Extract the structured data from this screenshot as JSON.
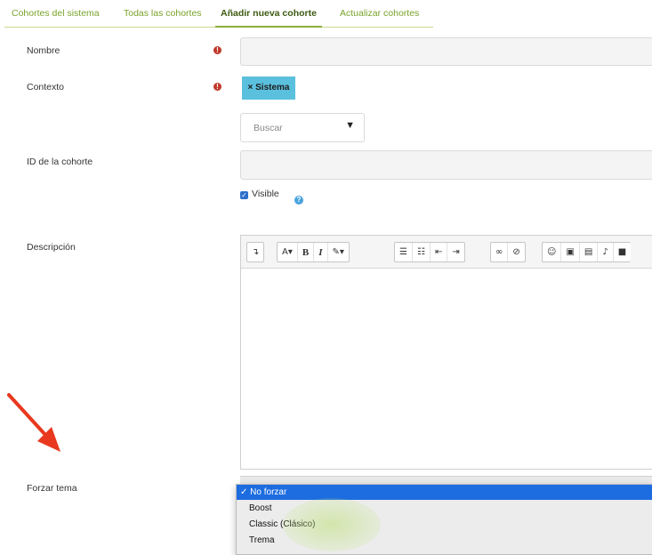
{
  "tabs": [
    {
      "label": "Cohortes del sistema",
      "active": false
    },
    {
      "label": "Todas las cohortes",
      "active": false
    },
    {
      "label": "Añadir nueva cohorte",
      "active": true
    },
    {
      "label": "Actualizar cohortes",
      "active": false
    }
  ],
  "form": {
    "name_label": "Nombre",
    "name_value": "",
    "context_label": "Contexto",
    "context_chip": "× Sistema",
    "search_placeholder": "Buscar",
    "search_caret": "▼",
    "required_icon": "!",
    "cohort_id_label": "ID de la cohorte",
    "cohort_id_value": "",
    "visible_label": "Visible",
    "visible_checked": true,
    "checkbox_glyph": "✓",
    "help_icon": "?",
    "description_label": "Descripción",
    "force_theme_label": "Forzar tema"
  },
  "editor": {
    "toolbar_icons": [
      "collapse-icon",
      "font-size-icon",
      "bold-icon",
      "italic-icon",
      "text-color-icon",
      "unordered-list-icon",
      "ordered-list-icon",
      "outdent-icon",
      "indent-icon",
      "link-icon",
      "unlink-icon",
      "emoticon-icon",
      "image-icon",
      "media-icon",
      "record-audio-icon",
      "record-video-icon"
    ]
  },
  "theme_dropdown": {
    "options": [
      "No forzar",
      "Boost",
      "Classic (Clásico)",
      "Trema"
    ],
    "selected": "No forzar",
    "check_glyph": "✓"
  },
  "colors": {
    "tab_link": "#7aa32b",
    "tab_active": "#3d5a12",
    "chip": "#5bc0de",
    "required": "#c0392b",
    "selection": "#1d6ce0",
    "annotation_arrow": "#e8391e"
  }
}
